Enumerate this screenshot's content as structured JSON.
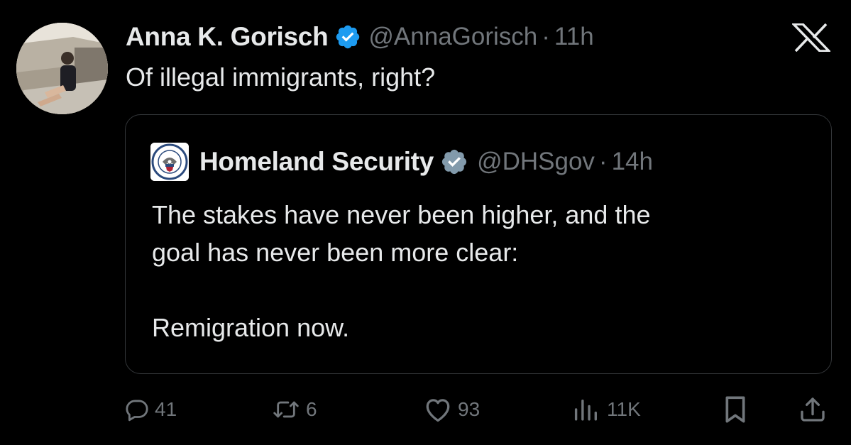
{
  "post": {
    "display_name": "Anna K. Gorisch",
    "handle": "@AnnaGorisch",
    "separator": "·",
    "time": "11h",
    "text": "Of illegal immigrants, right?",
    "verified": true
  },
  "quoted_post": {
    "display_name": "Homeland Security",
    "handle": "@DHSgov",
    "separator": "·",
    "time": "14h",
    "verified_badge": "gray",
    "lines": [
      "The stakes have never been higher, and the",
      "goal has never been more clear:",
      "",
      "Remigration now."
    ]
  },
  "actions": {
    "reply": {
      "icon": "reply-icon",
      "count": "41"
    },
    "repost": {
      "icon": "repost-icon",
      "count": "6"
    },
    "like": {
      "icon": "heart-icon",
      "count": "93"
    },
    "views": {
      "icon": "views-icon",
      "count": "11K"
    },
    "bookmark": {
      "icon": "bookmark-icon"
    },
    "share": {
      "icon": "share-icon"
    }
  },
  "colors": {
    "background": "#000000",
    "text_primary": "#e7e9ea",
    "text_secondary": "#71767b",
    "verified_blue": "#1d9bf0",
    "verified_gray": "#829aab",
    "border": "#333639"
  }
}
